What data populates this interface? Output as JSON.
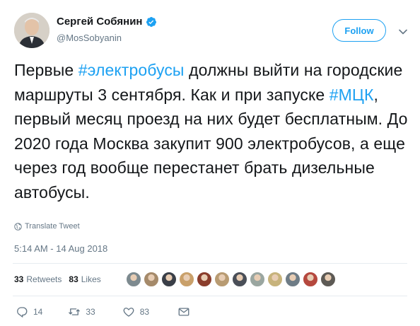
{
  "author": {
    "display_name": "Сергей Собянин",
    "handle": "@MosSobyanin",
    "verified": true
  },
  "follow_label": "Follow",
  "tweet": {
    "p1": "Первые ",
    "hashtag1": "#электробусы",
    "p2": " должны выйти на городские маршруты 3 сентября. Как и при запуске ",
    "hashtag2": "#МЦК",
    "p3": ", первый месяц проезд на них будет бесплатным. До 2020 года Москва закупит 900 электробусов, а еще через год вообще перестанет брать дизельные автобусы."
  },
  "translate_label": "Translate Tweet",
  "timestamp": "5:14 AM - 14 Aug 2018",
  "stats": {
    "retweets_count": "33",
    "retweets_label": "Retweets",
    "likes_count": "83",
    "likes_label": "Likes"
  },
  "liker_colors": [
    "#7d8a8f",
    "#a58a6a",
    "#3a3f48",
    "#c9a06a",
    "#8a3d2c",
    "#b89b72",
    "#4a4f58",
    "#9aa6a0",
    "#c7b37c",
    "#6e7c86",
    "#b5483e",
    "#5d5a55"
  ],
  "actions": {
    "reply_count": "14",
    "retweet_count": "33",
    "like_count": "83"
  },
  "icons": {
    "verified": "verified-badge-icon",
    "caret": "chevron-down-icon",
    "globe": "globe-icon",
    "reply": "reply-icon",
    "retweet": "retweet-icon",
    "like": "heart-icon",
    "dm": "envelope-icon"
  },
  "colors": {
    "accent": "#1da1f2",
    "text": "#14171a",
    "muted": "#657786",
    "divider": "#e6ecf0"
  }
}
